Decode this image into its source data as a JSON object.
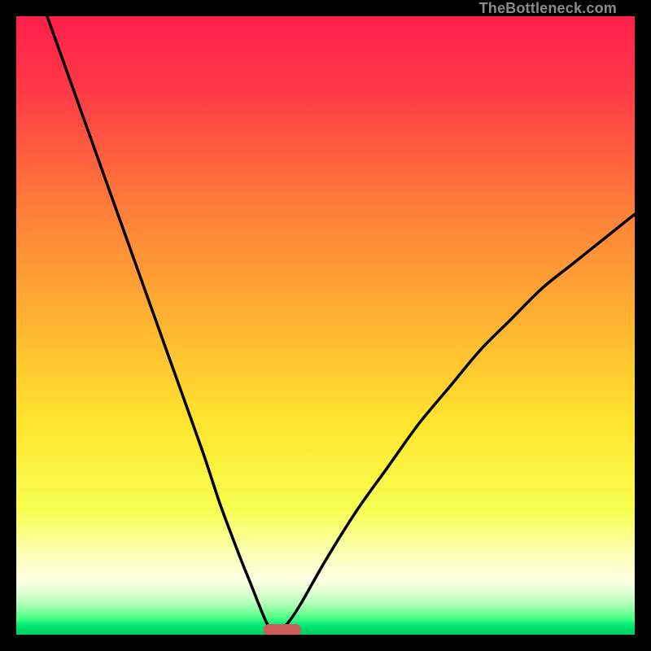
{
  "watermark": "TheBottleneck.com",
  "chart_data": {
    "type": "line",
    "title": "",
    "xlabel": "",
    "ylabel": "",
    "x_range": [
      0,
      100
    ],
    "y_range": [
      0,
      100
    ],
    "optimum_x": 42,
    "marker": {
      "x_start": 40,
      "x_end": 46,
      "y": 0,
      "color": "#cc5b5c"
    },
    "series": [
      {
        "name": "left-curve",
        "x": [
          5,
          10,
          15,
          20,
          25,
          30,
          33,
          36,
          38,
          40,
          41,
          42
        ],
        "y": [
          100,
          86,
          72,
          58,
          44,
          30,
          21,
          13,
          8,
          3,
          1,
          0
        ]
      },
      {
        "name": "right-curve",
        "x": [
          42,
          44,
          46,
          50,
          55,
          60,
          65,
          70,
          75,
          80,
          85,
          90,
          95,
          100
        ],
        "y": [
          0,
          2,
          5,
          12,
          20,
          27,
          34,
          40,
          46,
          51,
          56,
          60,
          64,
          68
        ]
      }
    ],
    "gradient_stops": [
      {
        "offset": 0.0,
        "color": "#ff1f4b"
      },
      {
        "offset": 0.12,
        "color": "#ff3a46"
      },
      {
        "offset": 0.3,
        "color": "#ff7a3a"
      },
      {
        "offset": 0.5,
        "color": "#ffb531"
      },
      {
        "offset": 0.66,
        "color": "#ffe52e"
      },
      {
        "offset": 0.8,
        "color": "#f7ff53"
      },
      {
        "offset": 0.86,
        "color": "#fbffa8"
      },
      {
        "offset": 0.91,
        "color": "#ffffe3"
      },
      {
        "offset": 0.935,
        "color": "#d9ffcf"
      },
      {
        "offset": 0.955,
        "color": "#9fffad"
      },
      {
        "offset": 0.972,
        "color": "#4fff86"
      },
      {
        "offset": 0.985,
        "color": "#00e874"
      },
      {
        "offset": 1.0,
        "color": "#00c866"
      }
    ]
  }
}
